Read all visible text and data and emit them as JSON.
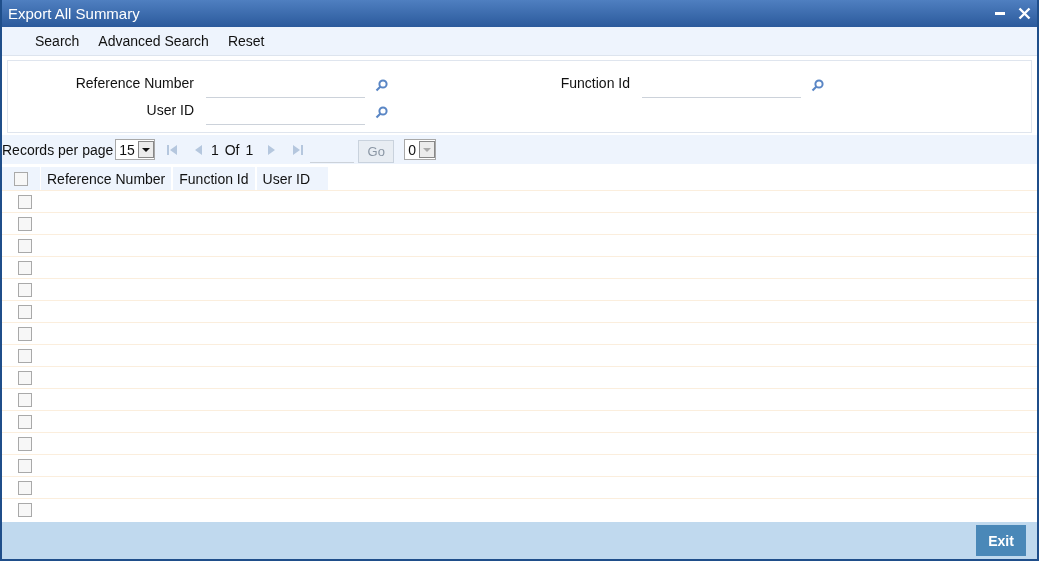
{
  "window": {
    "title": "Export All Summary"
  },
  "toolbar": [
    "Search",
    "Advanced Search",
    "Reset"
  ],
  "search_left": [
    {
      "label": "Reference Number"
    },
    {
      "label": "User ID"
    }
  ],
  "search_right": [
    {
      "label": "Function Id"
    }
  ],
  "pager": {
    "records_label": "Records per page",
    "records_value": "15",
    "page": "1",
    "of": "Of",
    "total": "1",
    "go": "Go",
    "go_disabled": true,
    "count_value": "0"
  },
  "table": {
    "header_checked": false,
    "columns": [
      "Reference Number",
      "Function Id",
      "User ID"
    ],
    "rows": [
      {
        "checked": false
      },
      {
        "checked": false
      },
      {
        "checked": false
      },
      {
        "checked": false
      },
      {
        "checked": false
      },
      {
        "checked": false
      },
      {
        "checked": false
      },
      {
        "checked": false
      },
      {
        "checked": false
      },
      {
        "checked": false
      },
      {
        "checked": false
      },
      {
        "checked": false
      },
      {
        "checked": false
      },
      {
        "checked": false
      },
      {
        "checked": false
      }
    ]
  },
  "footer": {
    "exit": "Exit"
  }
}
